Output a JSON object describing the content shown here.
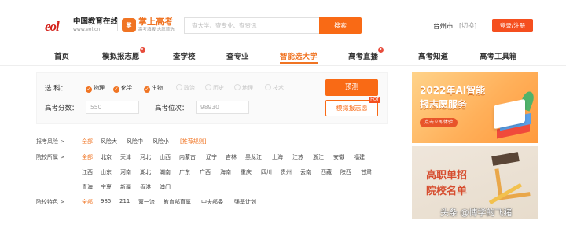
{
  "header": {
    "eol_logo": "eol",
    "eol_name": "中国教育在线",
    "eol_url": "www.eol.cn",
    "zsgk_badge": "掌",
    "zsgk_name": "掌上高考",
    "zsgk_slogan": "高考填报 志愿首选",
    "search_placeholder": "查大学、查专业、查资讯",
    "search_button": "搜索",
    "city": "台州市",
    "switch": "[切换]",
    "login": "登录/注册"
  },
  "nav": {
    "items": [
      "首页",
      "模拟报志愿",
      "查学校",
      "查专业",
      "智能选大学",
      "高考直播",
      "高考知道",
      "高考工具箱"
    ],
    "active": "智能选大学",
    "dot_marker": "•"
  },
  "filter": {
    "subject_label": "选    科：",
    "subjects": [
      {
        "name": "物理",
        "checked": true
      },
      {
        "name": "化学",
        "checked": true
      },
      {
        "name": "生物",
        "checked": true
      },
      {
        "name": "政治",
        "checked": false
      },
      {
        "name": "历史",
        "checked": false
      },
      {
        "name": "地理",
        "checked": false
      },
      {
        "name": "技术",
        "checked": false
      }
    ],
    "score_label": "高考分数：",
    "score_value": "550",
    "rank_label": "高考位次：",
    "rank_value": "98930",
    "predict_button": "预测",
    "mock_button": "模拟报志愿",
    "hot_badge": "HOT"
  },
  "tags": {
    "risk_label": "报考风险",
    "risk": [
      "全部",
      "风险大",
      "风险中",
      "风险小",
      "[推荐规则]"
    ],
    "location_label": "院校所属",
    "location_row1": [
      "全部",
      "北京",
      "天津",
      "河北",
      "山西",
      "内蒙古",
      "辽宁",
      "吉林",
      "黑龙江",
      "上海",
      "江苏",
      "浙江",
      "安徽",
      "福建"
    ],
    "location_row2": [
      "江西",
      "山东",
      "河南",
      "湖北",
      "湖南",
      "广东",
      "广西",
      "海南",
      "重庆",
      "四川",
      "贵州",
      "云南",
      "西藏",
      "陕西",
      "甘肃"
    ],
    "location_row3": [
      "青海",
      "宁夏",
      "新疆",
      "香港",
      "澳门"
    ],
    "feature_label": "院校特色",
    "feature": [
      "全部",
      "985",
      "211",
      "双一流",
      "教育部直属",
      "中央部委",
      "强基计划"
    ],
    "arrow": ">"
  },
  "banners": {
    "ai_title1": "2022年AI智能",
    "ai_title2": "报志愿服务",
    "ai_pill": "点击立即体验",
    "voc_title1": "高职单招",
    "voc_title2": "院校名单"
  },
  "watermark": "头条 @博学的飞猪",
  "colors": {
    "accent": "#f07423",
    "button": "#f96a15",
    "login": "#f54f1f"
  }
}
